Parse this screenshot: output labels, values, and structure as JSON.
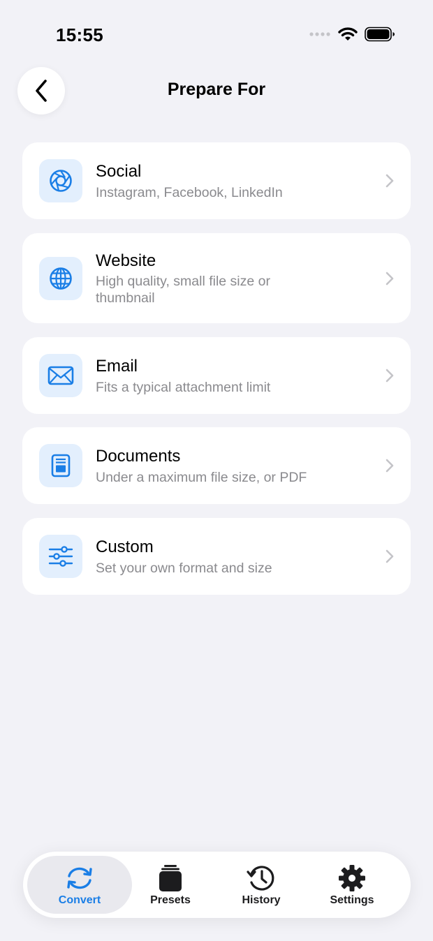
{
  "status_bar": {
    "time": "15:55"
  },
  "header": {
    "title": "Prepare For"
  },
  "options": [
    {
      "title": "Social",
      "subtitle": "Instagram, Facebook, LinkedIn",
      "icon": "aperture-icon"
    },
    {
      "title": "Website",
      "subtitle": "High quality, small file size or thumbnail",
      "icon": "globe-icon"
    },
    {
      "title": "Email",
      "subtitle": "Fits a typical attachment limit",
      "icon": "envelope-icon"
    },
    {
      "title": "Documents",
      "subtitle": "Under a maximum file size, or PDF",
      "icon": "document-icon"
    },
    {
      "title": "Custom",
      "subtitle": "Set your own format and size",
      "icon": "sliders-icon"
    }
  ],
  "tabbar": {
    "tabs": [
      {
        "label": "Convert",
        "icon": "convert-arrows-icon",
        "active": true
      },
      {
        "label": "Presets",
        "icon": "presets-stack-icon",
        "active": false
      },
      {
        "label": "History",
        "icon": "history-clock-icon",
        "active": false
      },
      {
        "label": "Settings",
        "icon": "gear-icon",
        "active": false
      }
    ]
  },
  "colors": {
    "accent": "#1a7ee6",
    "icon_tile_bg": "#e3effd",
    "background": "#f2f2f7"
  }
}
